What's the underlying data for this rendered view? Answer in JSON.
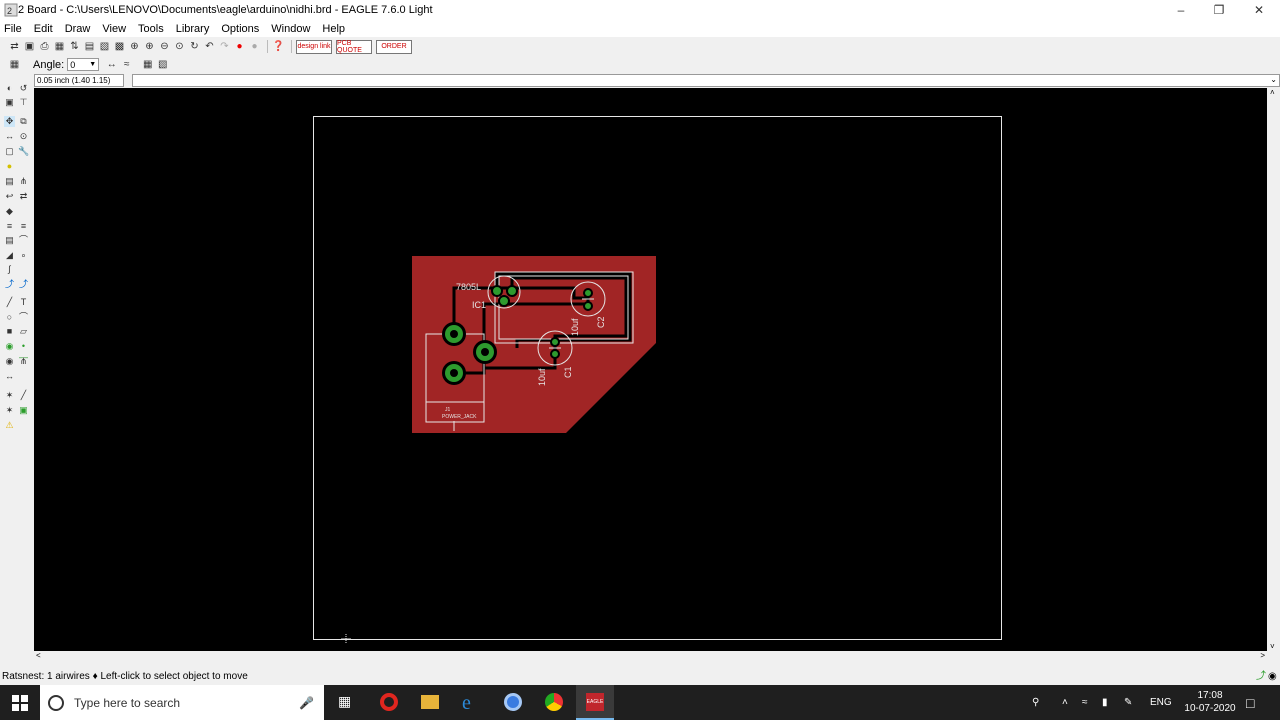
{
  "window": {
    "title": "2 Board - C:\\Users\\LENOVO\\Documents\\eagle\\arduino\\nidhi.brd - EAGLE 7.6.0 Light"
  },
  "menu": [
    "File",
    "Edit",
    "Draw",
    "View",
    "Tools",
    "Library",
    "Options",
    "Window",
    "Help"
  ],
  "params": {
    "angle_label": "Angle:",
    "angle_value": "0"
  },
  "coord": {
    "display": "0.05 inch (1.40 1.15)"
  },
  "toolbar_links": {
    "design_link": "design link",
    "pcb_quote": "PCB QUOTE",
    "order": "ORDER"
  },
  "board": {
    "components": {
      "ic_name": "7805L",
      "ic_ref": "IC1",
      "c1_ref": "C1",
      "c1_val": "10uf",
      "c2_ref": "C2",
      "c2_val": "10uf",
      "jack_ref": "J1",
      "jack_val": "POWER_JACK"
    }
  },
  "status": {
    "text": "Ratsnest: 1 airwires ♦ Left-click to select object to move"
  },
  "taskbar": {
    "search_placeholder": "Type here to search",
    "lang": "ENG",
    "time": "17:08",
    "date": "10-07-2020"
  }
}
